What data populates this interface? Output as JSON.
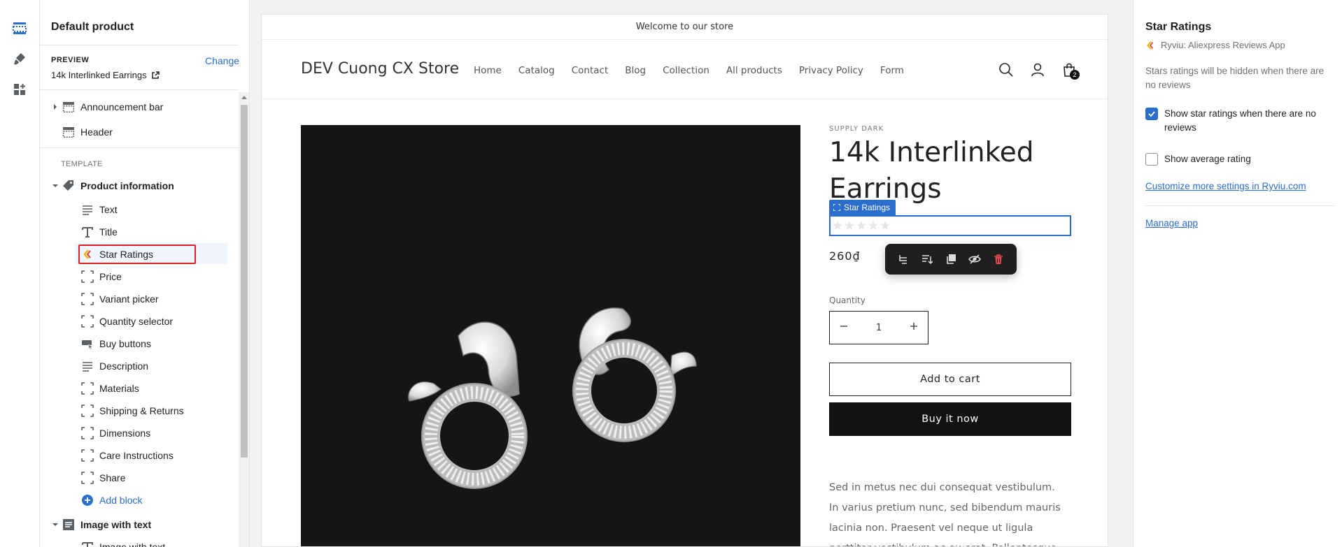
{
  "rail": {
    "items": [
      "sections-icon",
      "theme-settings-icon",
      "app-embeds-icon"
    ]
  },
  "sidebar": {
    "title": "Default product",
    "preview_label": "PREVIEW",
    "preview_change": "Change",
    "preview_value": "14k Interlinked Earrings",
    "header_items": [
      {
        "label": "Announcement bar"
      },
      {
        "label": "Header"
      }
    ],
    "template_label": "TEMPLATE",
    "section_product": "Product information",
    "blocks": [
      {
        "label": "Text",
        "icon": "text-icon"
      },
      {
        "label": "Title",
        "icon": "title-icon"
      },
      {
        "label": "Star Ratings",
        "icon": "ryviu-icon"
      },
      {
        "label": "Price",
        "icon": "block-icon"
      },
      {
        "label": "Variant picker",
        "icon": "block-icon"
      },
      {
        "label": "Quantity selector",
        "icon": "block-icon"
      },
      {
        "label": "Buy buttons",
        "icon": "buy-buttons-icon"
      },
      {
        "label": "Description",
        "icon": "text-icon"
      },
      {
        "label": "Materials",
        "icon": "block-icon"
      },
      {
        "label": "Shipping & Returns",
        "icon": "block-icon"
      },
      {
        "label": "Dimensions",
        "icon": "block-icon"
      },
      {
        "label": "Care Instructions",
        "icon": "block-icon"
      },
      {
        "label": "Share",
        "icon": "block-icon"
      }
    ],
    "add_block": "Add block",
    "section_image_text": "Image with text",
    "partial_item": "Image with text"
  },
  "store": {
    "announcement": "Welcome to our store",
    "name": "DEV Cuong CX Store",
    "nav": [
      "Home",
      "Catalog",
      "Contact",
      "Blog",
      "Collection",
      "All products",
      "Privacy Policy",
      "Form"
    ],
    "cart_count": "2",
    "product": {
      "vendor": "SUPPLY DARK",
      "title": "14k Interlinked Earrings",
      "rating_tag": "Star Ratings",
      "rating_value": 0,
      "rating_max": 5,
      "price": "260₫",
      "quantity_label": "Quantity",
      "quantity": "1",
      "add_to_cart": "Add to cart",
      "buy_now": "Buy it now",
      "description": "Sed in metus nec dui consequat vestibulum. In varius pretium nunc, sed bibendum mauris lacinia non. Praesent vel neque ut ligula porttitor vestibulum ac eu erat. Pellentesque"
    }
  },
  "toolbar": {
    "buttons": [
      "select-parent-icon",
      "move-icon",
      "duplicate-icon",
      "hide-icon",
      "delete-icon"
    ]
  },
  "settings": {
    "title": "Star Ratings",
    "app_name": "Ryviu: Aliexpress Reviews App",
    "info": "Stars ratings will be hidden when there are no reviews",
    "check_show_no_reviews": "Show star ratings when there are no reviews",
    "check_show_no_reviews_checked": true,
    "check_average": "Show average rating",
    "check_average_checked": false,
    "link_customize": "Customize more settings in Ryviu.com",
    "link_manage": "Manage app"
  },
  "colors": {
    "accent": "#2c6ecb",
    "selection_outline": "#e02020",
    "delete": "#e5484d"
  }
}
